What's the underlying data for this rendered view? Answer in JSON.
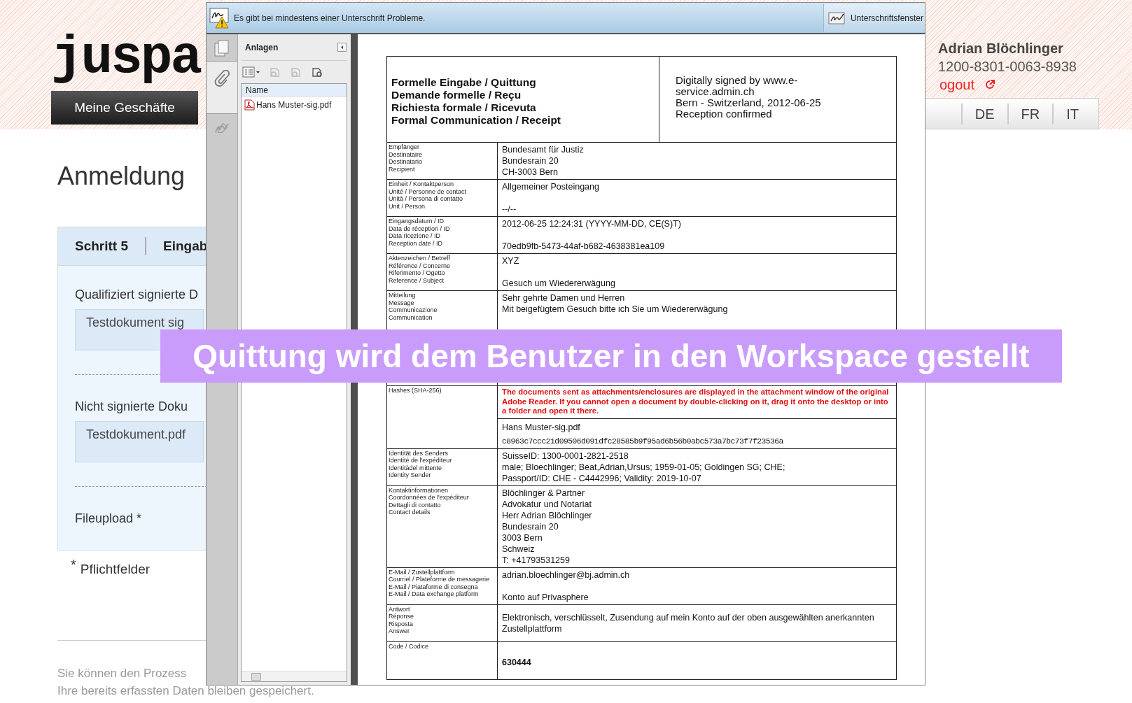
{
  "site": {
    "logo": "juspa",
    "nav": [
      "Meine Geschäfte"
    ],
    "user": {
      "name": "Adrian Blöchlinger",
      "id": "1200-8301-0063-8938",
      "logout": "ogout"
    },
    "languages": [
      "DE",
      "FR",
      "IT"
    ],
    "heading": "Anmeldung",
    "steps": [
      "Schritt 5",
      "Eingab"
    ],
    "fields": [
      {
        "label": "Qualifiziert signierte D",
        "value": "Testdokument sig"
      },
      {
        "label": "Nicht signierte Doku",
        "value": "Testdokument.pdf"
      },
      {
        "label": "Fileupload *"
      }
    ],
    "required_note": {
      "mark": "*",
      "text": "Pflichtfelder"
    },
    "footer_lines": [
      "Sie können den Prozess",
      "Ihre bereits erfassten Daten bleiben gespeichert."
    ]
  },
  "reader": {
    "message": "Es gibt bei mindestens einer Unterschrift Probleme.",
    "signature_button": "Unterschriftsfenster",
    "side_tabs": [
      {
        "kind": "pages",
        "selected": false
      },
      {
        "kind": "attachments",
        "selected": true
      },
      {
        "kind": "signatures",
        "selected": false
      }
    ],
    "panel": {
      "title": "Anlagen",
      "column": "Name",
      "files": [
        "Hans Muster-sig.pdf"
      ]
    }
  },
  "document": {
    "title_lines": [
      "Formelle Eingabe / Quittung",
      "Demande formelle / Reçu",
      "Richiesta formale / Ricevuta",
      "Formal Communication / Receipt"
    ],
    "signature_lines": [
      "Digitally signed by www.e-",
      "service.admin.ch",
      "Bern - Switzerland, 2012-06-25",
      "Reception confirmed"
    ],
    "rows": [
      {
        "kind": "plain",
        "labels": [
          "Empfänger",
          "Destinataire",
          "Destinatario",
          "Recipient"
        ],
        "values": [
          {
            "kind": "text",
            "text": "Bundesamt für Justiz"
          },
          {
            "kind": "text",
            "text": "Bundesrain 20"
          },
          {
            "kind": "text",
            "text": "CH-3003 Bern"
          }
        ]
      },
      {
        "kind": "plain",
        "labels": [
          "Einheit / Kontaktperson",
          "Unité / Personne de contact",
          "Unità / Persona di contatto",
          "Unit / Person"
        ],
        "values": [
          {
            "kind": "text",
            "text": "Allgemeiner Posteingang"
          },
          {
            "kind": "text",
            "text": "--/--"
          }
        ]
      },
      {
        "kind": "plain",
        "labels": [
          "Eingangsdatum / ID",
          "Data de réception / ID",
          "Data ricezione / ID",
          "Reception date / ID"
        ],
        "values": [
          {
            "kind": "text",
            "text": "2012-06-25 12:24:31 (YYYY-MM-DD, CE(S)T)"
          },
          {
            "kind": "text",
            "text": "70edb9fb-5473-44af-b682-4638381ea109"
          }
        ]
      },
      {
        "kind": "plain",
        "labels": [
          "Aktenzeichen / Betreff",
          "Référence / Concerne",
          "Riferimento / Ogetto",
          "Reference / Subject"
        ],
        "values": [
          {
            "kind": "text",
            "text": "XYZ"
          },
          {
            "kind": "text",
            "text": "Gesuch um Wiedererwägung"
          }
        ]
      },
      {
        "kind": "message",
        "labels": [
          "Mitteilung",
          "Message",
          "Communicazione",
          "Communication"
        ],
        "values": [
          {
            "kind": "text",
            "text": "Sehr gehrte Damen und Herren"
          },
          {
            "kind": "text",
            "text": "Mit beigefügtem Gesuch bitte ich Sie um Wiedererwägung"
          }
        ]
      },
      {
        "kind": "attachments",
        "labels": [
          "Hashes (SHA-256)"
        ],
        "values": [
          {
            "kind": "warning",
            "text": "The documents sent as attachments/enclosures are displayed in the attachment window of the original Adobe Reader. If you cannot open a document by double-clicking on it, drag it onto the desktop or into a folder and open it there."
          },
          {
            "kind": "file",
            "text": "Hans Muster-sig.pdf"
          },
          {
            "kind": "hash",
            "text": "c8963c7ccc21d09506d091dfc28585b9f95ad6b56b0abc573a7bc73f7f23536a"
          }
        ]
      },
      {
        "kind": "plain",
        "labels": [
          "Identität des Senders",
          "Identité de l'expéditeur",
          "Identitàdel mittente",
          "Identity Sender"
        ],
        "values": [
          {
            "kind": "text",
            "text": "SuisseID: 1300-0001-2821-2518"
          },
          {
            "kind": "text",
            "text": "male; Bloechlinger; Beat,Adrian,Ursus; 1959-01-05; Goldingen SG; CHE;"
          },
          {
            "kind": "text",
            "text": "Passport/ID: CHE - C4442996; Validity: 2019-10-07"
          }
        ]
      },
      {
        "kind": "plain",
        "labels": [
          "Kontaktinformationen",
          "Coordonnées de l'expéditeur",
          "Dettagli di contatto",
          "Contact details"
        ],
        "values": [
          {
            "kind": "text",
            "text": "Blöchlinger & Partner"
          },
          {
            "kind": "text",
            "text": "Advokatur und Notariat"
          },
          {
            "kind": "text",
            "text": "Herr Adrian Blöchlinger"
          },
          {
            "kind": "text",
            "text": "Bundesrain 20"
          },
          {
            "kind": "text",
            "text": "3003 Bern"
          },
          {
            "kind": "text",
            "text": "Schweiz"
          },
          {
            "kind": "text",
            "text": "T: +41793531259"
          }
        ]
      },
      {
        "kind": "plain",
        "labels": [
          "E-Mail / Zustellplattform",
          "Courriel / Plateforme de messagerie",
          "E-Mail / Piataforme di consegna",
          "E-Mail / Data exchange platform"
        ],
        "values": [
          {
            "kind": "text",
            "text": "adrian.bloechlinger@bj.admin.ch"
          },
          {
            "kind": "text",
            "text": "Konto auf Privasphere"
          }
        ]
      },
      {
        "kind": "plain",
        "labels": [
          "Antwort",
          "Réponse",
          "Risposta",
          "Answer"
        ],
        "values": [
          {
            "kind": "text",
            "text": "Elektronisch, verschlüsselt, Zusendung auf mein Konto auf der oben ausgewählten anerkannten Zustellplattform"
          }
        ]
      },
      {
        "kind": "plain",
        "labels": [
          "Code / Codice"
        ],
        "values": [
          {
            "kind": "code",
            "text": "630444"
          }
        ]
      }
    ]
  },
  "caption": "Quittung wird dem Benutzer in den Workspace gestellt"
}
